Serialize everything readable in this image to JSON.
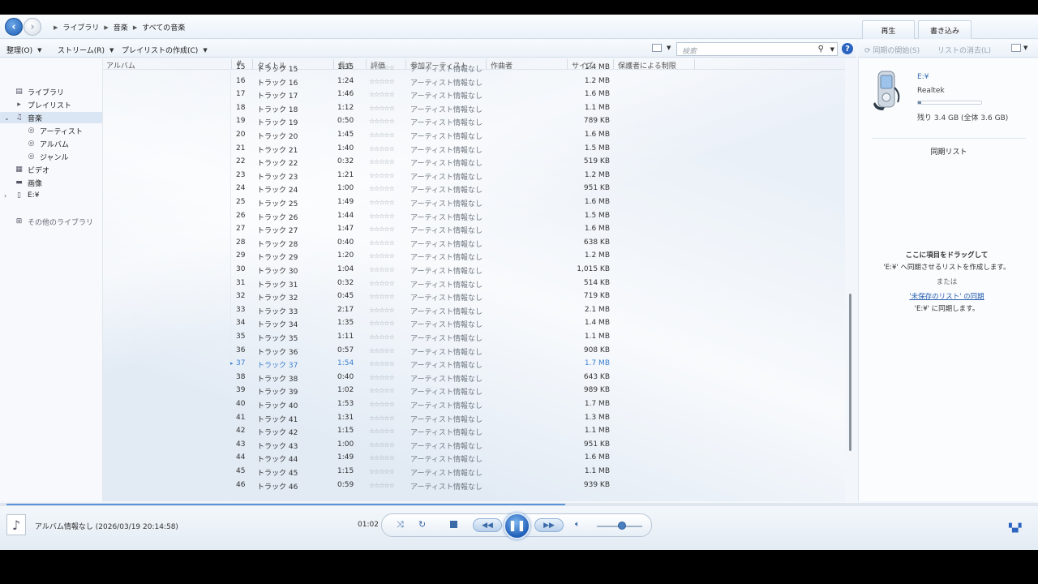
{
  "nav": {
    "breadcrumb": [
      "ライブラリ",
      "音楽",
      "すべての音楽"
    ],
    "tabs": {
      "play": "再生",
      "burn": "書き込み"
    }
  },
  "toolbar": {
    "organize": "整理(O)",
    "stream": "ストリーム(R)",
    "create_playlist": "プレイリストの作成(C)",
    "search_placeholder": "検索",
    "sync_start": "同期の開始(S)",
    "clear_list": "リストの消去(L)"
  },
  "sidebar": {
    "items": [
      {
        "label": "ライブラリ",
        "icon": "library-icon"
      },
      {
        "label": "プレイリスト",
        "icon": "playlist-icon"
      },
      {
        "label": "音楽",
        "icon": "music-note-icon"
      },
      {
        "label": "アーティスト",
        "icon": "artist-icon"
      },
      {
        "label": "アルバム",
        "icon": "album-icon"
      },
      {
        "label": "ジャンル",
        "icon": "genre-icon"
      },
      {
        "label": "ビデオ",
        "icon": "video-icon"
      },
      {
        "label": "画像",
        "icon": "picture-icon"
      },
      {
        "label": "E:¥",
        "icon": "device-icon"
      },
      {
        "label": "その他のライブラリ",
        "icon": "other-libraries-icon"
      }
    ]
  },
  "columns": {
    "album": "アルバム",
    "num": "#",
    "title": "タイトル",
    "length": "長さ",
    "rating": "評価",
    "artist": "参加アーティスト",
    "composer": "作曲者",
    "size": "サイズ",
    "parental": "保護者による制限"
  },
  "tracks": [
    {
      "num": "15",
      "title": "トラック 15",
      "length": "1:35",
      "rating": 0,
      "artist": "アーティスト情報なし",
      "size": "1.4 MB"
    },
    {
      "num": "16",
      "title": "トラック 16",
      "length": "1:24",
      "rating": 0,
      "artist": "アーティスト情報なし",
      "size": "1.2 MB"
    },
    {
      "num": "17",
      "title": "トラック 17",
      "length": "1:46",
      "rating": 0,
      "artist": "アーティスト情報なし",
      "size": "1.6 MB"
    },
    {
      "num": "18",
      "title": "トラック 18",
      "length": "1:12",
      "rating": 0,
      "artist": "アーティスト情報なし",
      "size": "1.1 MB"
    },
    {
      "num": "19",
      "title": "トラック 19",
      "length": "0:50",
      "rating": 0,
      "artist": "アーティスト情報なし",
      "size": "789 KB"
    },
    {
      "num": "20",
      "title": "トラック 20",
      "length": "1:45",
      "rating": 0,
      "artist": "アーティスト情報なし",
      "size": "1.6 MB"
    },
    {
      "num": "21",
      "title": "トラック 21",
      "length": "1:40",
      "rating": 0,
      "artist": "アーティスト情報なし",
      "size": "1.5 MB"
    },
    {
      "num": "22",
      "title": "トラック 22",
      "length": "0:32",
      "rating": 0,
      "artist": "アーティスト情報なし",
      "size": "519 KB"
    },
    {
      "num": "23",
      "title": "トラック 23",
      "length": "1:21",
      "rating": 0,
      "artist": "アーティスト情報なし",
      "size": "1.2 MB"
    },
    {
      "num": "24",
      "title": "トラック 24",
      "length": "1:00",
      "rating": 0,
      "artist": "アーティスト情報なし",
      "size": "951 KB"
    },
    {
      "num": "25",
      "title": "トラック 25",
      "length": "1:49",
      "rating": 0,
      "artist": "アーティスト情報なし",
      "size": "1.6 MB"
    },
    {
      "num": "26",
      "title": "トラック 26",
      "length": "1:44",
      "rating": 0,
      "artist": "アーティスト情報なし",
      "size": "1.5 MB"
    },
    {
      "num": "27",
      "title": "トラック 27",
      "length": "1:47",
      "rating": 0,
      "artist": "アーティスト情報なし",
      "size": "1.6 MB"
    },
    {
      "num": "28",
      "title": "トラック 28",
      "length": "0:40",
      "rating": 0,
      "artist": "アーティスト情報なし",
      "size": "638 KB"
    },
    {
      "num": "29",
      "title": "トラック 29",
      "length": "1:20",
      "rating": 0,
      "artist": "アーティスト情報なし",
      "size": "1.2 MB"
    },
    {
      "num": "30",
      "title": "トラック 30",
      "length": "1:04",
      "rating": 0,
      "artist": "アーティスト情報なし",
      "size": "1,015 KB"
    },
    {
      "num": "31",
      "title": "トラック 31",
      "length": "0:32",
      "rating": 0,
      "artist": "アーティスト情報なし",
      "size": "514 KB"
    },
    {
      "num": "32",
      "title": "トラック 32",
      "length": "0:45",
      "rating": 0,
      "artist": "アーティスト情報なし",
      "size": "719 KB"
    },
    {
      "num": "33",
      "title": "トラック 33",
      "length": "2:17",
      "rating": 0,
      "artist": "アーティスト情報なし",
      "size": "2.1 MB"
    },
    {
      "num": "34",
      "title": "トラック 34",
      "length": "1:35",
      "rating": 0,
      "artist": "アーティスト情報なし",
      "size": "1.4 MB"
    },
    {
      "num": "35",
      "title": "トラック 35",
      "length": "1:11",
      "rating": 0,
      "artist": "アーティスト情報なし",
      "size": "1.1 MB"
    },
    {
      "num": "36",
      "title": "トラック 36",
      "length": "0:57",
      "rating": 0,
      "artist": "アーティスト情報なし",
      "size": "908 KB"
    },
    {
      "num": "37",
      "title": "トラック 37",
      "length": "1:54",
      "rating": 0,
      "artist": "アーティスト情報なし",
      "size": "1.7 MB",
      "current": true
    },
    {
      "num": "38",
      "title": "トラック 38",
      "length": "0:40",
      "rating": 0,
      "artist": "アーティスト情報なし",
      "size": "643 KB"
    },
    {
      "num": "39",
      "title": "トラック 39",
      "length": "1:02",
      "rating": 0,
      "artist": "アーティスト情報なし",
      "size": "989 KB"
    },
    {
      "num": "40",
      "title": "トラック 40",
      "length": "1:53",
      "rating": 0,
      "artist": "アーティスト情報なし",
      "size": "1.7 MB"
    },
    {
      "num": "41",
      "title": "トラック 41",
      "length": "1:31",
      "rating": 0,
      "artist": "アーティスト情報なし",
      "size": "1.3 MB"
    },
    {
      "num": "42",
      "title": "トラック 42",
      "length": "1:15",
      "rating": 0,
      "artist": "アーティスト情報なし",
      "size": "1.1 MB"
    },
    {
      "num": "43",
      "title": "トラック 43",
      "length": "1:00",
      "rating": 0,
      "artist": "アーティスト情報なし",
      "size": "951 KB"
    },
    {
      "num": "44",
      "title": "トラック 44",
      "length": "1:49",
      "rating": 0,
      "artist": "アーティスト情報なし",
      "size": "1.6 MB"
    },
    {
      "num": "45",
      "title": "トラック 45",
      "length": "1:15",
      "rating": 0,
      "artist": "アーティスト情報なし",
      "size": "1.1 MB"
    },
    {
      "num": "46",
      "title": "トラック 46",
      "length": "0:59",
      "rating": 0,
      "artist": "アーティスト情報なし",
      "size": "939 KB"
    }
  ],
  "sync": {
    "device_name": "E:¥",
    "device_brand": "Realtek",
    "storage_used_fraction": 0.05,
    "storage_text": "残り 3.4 GB (全体 3.6 GB)",
    "list_title": "同期リスト",
    "msg_line1": "ここに項目をドラッグして",
    "msg_line2": "'E:¥' へ同期させるリストを作成します。",
    "msg_or": "または",
    "msg_link": "'未保存のリスト' の同期",
    "msg_line3": "'E:¥' に同期します。"
  },
  "player": {
    "now_playing": "アルバム情報なし (2026/03/19 20:14:58)",
    "elapsed": "01:02",
    "seek_progress": 0.545,
    "volume": 0.55
  },
  "colors": {
    "accent": "#2a64c0",
    "current_track": "#3b7fd0"
  }
}
